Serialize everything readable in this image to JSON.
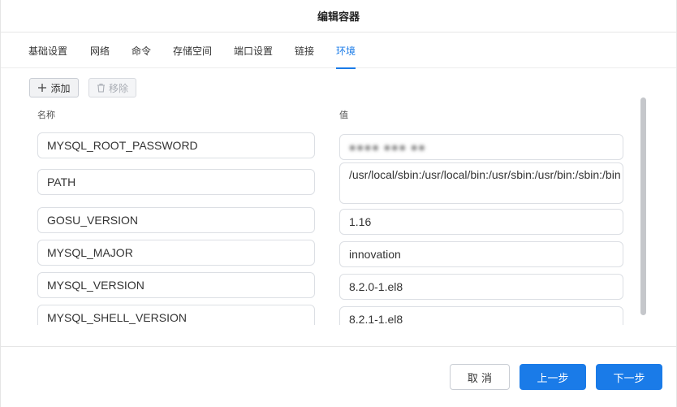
{
  "dialog": {
    "title": "编辑容器"
  },
  "tabs": [
    {
      "label": "基础设置"
    },
    {
      "label": "网络"
    },
    {
      "label": "命令"
    },
    {
      "label": "存储空间"
    },
    {
      "label": "端口设置"
    },
    {
      "label": "链接"
    },
    {
      "label": "环境",
      "active": true
    }
  ],
  "toolbar": {
    "add_label": "添加",
    "remove_label": "移除"
  },
  "columns": {
    "name": "名称",
    "value": "值"
  },
  "env": [
    {
      "name": "MYSQL_ROOT_PASSWORD",
      "value": ""
    },
    {
      "name": "PATH",
      "value": "/usr/local/sbin:/usr/local/bin:/usr/sbin:/usr/bin:/sbin:/bin"
    },
    {
      "name": "GOSU_VERSION",
      "value": "1.16"
    },
    {
      "name": "MYSQL_MAJOR",
      "value": "innovation"
    },
    {
      "name": "MYSQL_VERSION",
      "value": "8.2.0-1.el8"
    },
    {
      "name": "MYSQL_SHELL_VERSION",
      "value": "8.2.1-1.el8"
    }
  ],
  "footer": {
    "cancel_label": "取 消",
    "prev_label": "上一步",
    "next_label": "下一步"
  },
  "colors": {
    "accent": "#1a7be8"
  }
}
